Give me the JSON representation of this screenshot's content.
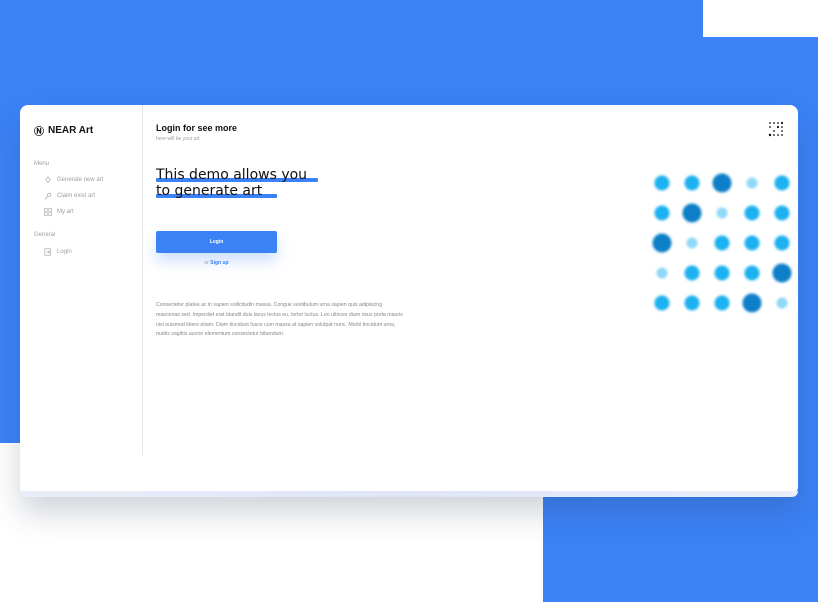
{
  "brand": {
    "name": "NEAR Art",
    "logo_glyph": "Ⓝ"
  },
  "sidebar": {
    "sections": [
      {
        "title": "Menu",
        "items": [
          {
            "label": "Generate new art",
            "icon": "bulb-icon"
          },
          {
            "label": "Claim exist art",
            "icon": "key-icon"
          },
          {
            "label": "My art",
            "icon": "grid-icon"
          }
        ]
      },
      {
        "title": "General",
        "items": [
          {
            "label": "Login",
            "icon": "login-icon"
          }
        ]
      }
    ]
  },
  "header": {
    "title": "Login for see more",
    "subtitle": "here will be your art"
  },
  "hero": {
    "headline_line1": "This demo allows you",
    "headline_line2": "to generate art"
  },
  "auth": {
    "login_label": "Login",
    "or_text": "or",
    "signup_label": "Sign up"
  },
  "description": "Consectetur platea ac in sapien sollicitudin massa. Congue vestibulum urna sapien quis adipiscing maecenas sed. Imperdiet erat blandit duis lacus lectus eu, tortor luctus. Leo ultrices diam risus porta mauris nisl euismod libero etiam. Diam tincidunt fusce cum massa at sapien volutpat nunc. Morbi tincidunt urna, mattis sagittis auctor elementum consectetur bibendum.",
  "colors": {
    "accent": "#3b82f6",
    "dot_light": "#8fd8f7",
    "dot_mid": "#1ab1f0",
    "dot_dark": "#0a7fc8"
  },
  "art_grid": [
    [
      "mid",
      "mid",
      "dark",
      "light",
      "mid"
    ],
    [
      "mid",
      "dark",
      "light",
      "mid",
      "mid"
    ],
    [
      "dark",
      "light",
      "mid",
      "mid",
      "mid"
    ],
    [
      "light",
      "mid",
      "mid",
      "mid",
      "dark"
    ],
    [
      "mid",
      "mid",
      "mid",
      "dark",
      "light"
    ]
  ]
}
